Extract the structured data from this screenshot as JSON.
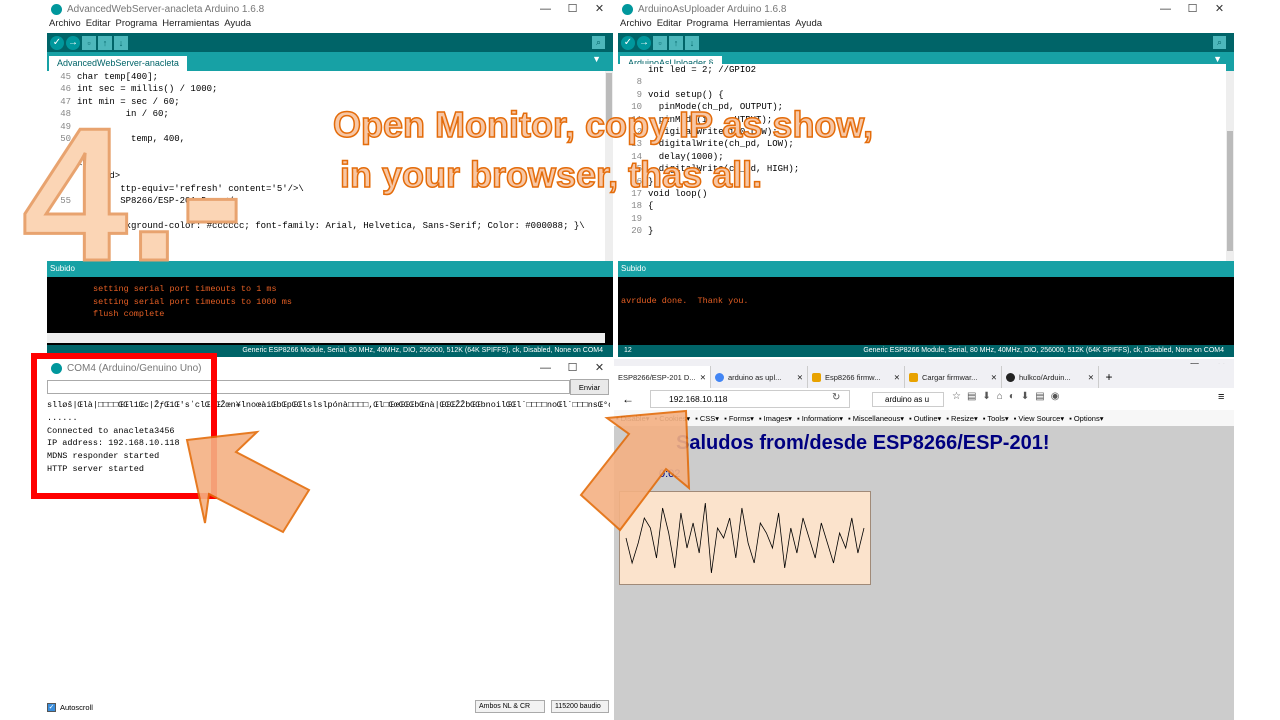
{
  "left_ide": {
    "title": "AdvancedWebServer-anacleta Arduino 1.6.8",
    "menu": [
      "Archivo",
      "Editar",
      "Programa",
      "Herramientas",
      "Ayuda"
    ],
    "tab": "AdvancedWebServer-anacleta",
    "code": [
      {
        "n": "45",
        "t": "char temp[400];"
      },
      {
        "n": "46",
        "t": "int sec = millis() / 1000;"
      },
      {
        "n": "47",
        "t": "int min = sec / 60;"
      },
      {
        "n": "48",
        "t": "         in / 60;"
      },
      {
        "n": "49",
        "t": ""
      },
      {
        "n": "50",
        "t": "          temp, 400,"
      },
      {
        "n": "",
        "t": ""
      },
      {
        "n": "",
        "t": "<html>"
      },
      {
        "n": "",
        "t": "  <head>"
      },
      {
        "n": "",
        "t": "     <  ttp-equiv='refresh' content='5'/>\\"
      },
      {
        "n": "55",
        "t": "     <  SP8266/ESP-201 Demo</"
      },
      {
        "n": "",
        "t": ""
      },
      {
        "n": "",
        "t": "         kground-color: #cccccc; font-family: Arial, Helvetica, Sans-Serif; Color: #000088; }\\"
      }
    ],
    "status": "Subido",
    "console": [
      "setting serial port timeouts to 1 ms",
      "setting serial port timeouts to 1000 ms",
      "flush complete"
    ],
    "board": "Generic ESP8266 Module, Serial, 80 MHz, 40MHz, DIO, 256000, 512K (64K SPIFFS), ck, Disabled, None on COM4"
  },
  "right_ide": {
    "title": "ArduinoAsUploader Arduino 1.6.8",
    "menu": [
      "Archivo",
      "Editar",
      "Programa",
      "Herramientas",
      "Ayuda"
    ],
    "tab": "ArduinoAsUploader §",
    "code": [
      {
        "n": "",
        "t": "int led = 2; //GPIO2"
      },
      {
        "n": "8",
        "t": ""
      },
      {
        "n": "9",
        "t": "void setup() {"
      },
      {
        "n": "10",
        "t": "  pinMode(ch_pd, OUTPUT);"
      },
      {
        "n": "11",
        "t": "  pinMode(io    UTPUT);"
      },
      {
        "n": "12",
        "t": "  digitalWrite(io0,LOW);"
      },
      {
        "n": "13",
        "t": "  digitalWrite(ch_pd, LOW);"
      },
      {
        "n": "14",
        "t": "  delay(1000);"
      },
      {
        "n": "15",
        "t": "  digitalWrite(ch_pd, HIGH);"
      },
      {
        "n": "16",
        "t": "}"
      },
      {
        "n": "17",
        "t": "void loop()"
      },
      {
        "n": "18",
        "t": "{"
      },
      {
        "n": "19",
        "t": ""
      },
      {
        "n": "20",
        "t": "}"
      }
    ],
    "status": "Subido",
    "console": [
      "avrdude done.  Thank you."
    ],
    "line": "12",
    "board": "Generic ESP8266 Module, Serial, 80 MHz, 40MHz, DIO, 256000, 512K (64K SPIFFS), ck, Disabled, None on COM4"
  },
  "serial": {
    "title": "COM4 (Arduino/Genuino Uno)",
    "send": "Enviar",
    "lines": [
      "slløš|Œlà|□□□□ŒŒl1Œc|ŽƒŒ1Œ'sʼclŒbŒŽœn¥lnoœàiŒbŒpŒŒlslslpónà□□□□,Œl□ŒœŒŒŒbŒnà|ŒŒŒŽŽbŒŒbnoilŒŒl`□□□□noŒl`□□□nsŒ°o□□,Œ",
      "......",
      "Connected to anacleta3456",
      "IP address: 192.168.10.118",
      "MDNS responder started",
      "HTTP server started"
    ],
    "autoscroll": "Autoscroll",
    "line_ending": "Ambos NL & CR",
    "baud": "115200 baudio"
  },
  "browser": {
    "tabs": [
      "ESP8266/ESP-201 D...",
      "arduino as upl...",
      "Esp8266 firmw...",
      "Cargar firmwar...",
      "hulkco/Arduin..."
    ],
    "url": "192.168.10.118",
    "search": "arduino as u",
    "bookmarks": [
      "Disable",
      "Cookies",
      "CSS",
      "Forms",
      "Images",
      "Information",
      "Miscellaneous",
      "Outline",
      "Resize",
      "Tools",
      "View Source",
      "Options"
    ],
    "heading": "Saludos from/desde ESP8266/ESP-201!",
    "uptime_partial": "0:02"
  },
  "overlay": {
    "line1": "Open Monitor, copy IP as show,",
    "line2": "in your browser, thas all.",
    "step": "4.-"
  },
  "chart_data": {
    "type": "line",
    "series": [
      {
        "values": [
          40,
          15,
          35,
          60,
          50,
          20,
          70,
          45,
          10,
          65,
          30,
          55,
          25,
          75,
          5,
          50,
          40,
          60,
          20,
          70,
          35,
          15,
          55,
          45,
          30,
          65,
          10,
          50,
          25,
          60,
          40,
          20,
          55,
          35,
          15,
          45,
          30,
          60,
          25,
          50
        ]
      }
    ]
  }
}
